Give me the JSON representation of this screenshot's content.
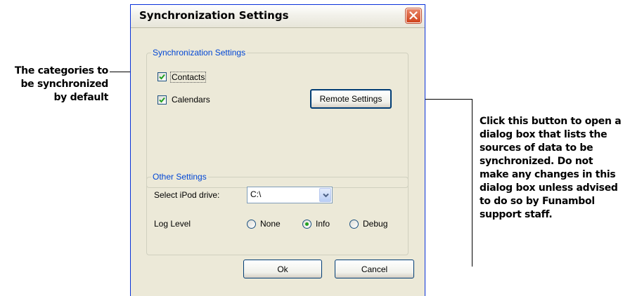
{
  "window": {
    "title": "Synchronization Settings",
    "close_icon": "close-x-icon"
  },
  "sync_group": {
    "legend": "Synchronization Settings",
    "contacts_label": "Contacts",
    "contacts_checked": true,
    "calendars_label": "Calendars",
    "calendars_checked": true,
    "remote_settings_button": "Remote Settings"
  },
  "other_group": {
    "legend": "Other Settings",
    "ipod_drive_label": "Select iPod drive:",
    "ipod_drive_value": "C:\\",
    "log_level_label": "Log Level",
    "log_options": [
      {
        "label": "None",
        "selected": false
      },
      {
        "label": "Info",
        "selected": true
      },
      {
        "label": "Debug",
        "selected": false
      }
    ]
  },
  "buttons": {
    "ok": "Ok",
    "cancel": "Cancel"
  },
  "annotations": {
    "left": [
      "The categories to",
      "be synchronized",
      "by default"
    ],
    "right": [
      "Click this button to open a",
      "dialog box that lists the",
      "sources of data to be",
      "synchronized. Do not",
      "make any changes in this",
      "dialog box unless advised",
      "to do so by Funambol",
      "support staff."
    ]
  },
  "colors": {
    "group_legend": "#0046d5",
    "check_mark": "#21a121",
    "close_button": "#d0431c"
  }
}
